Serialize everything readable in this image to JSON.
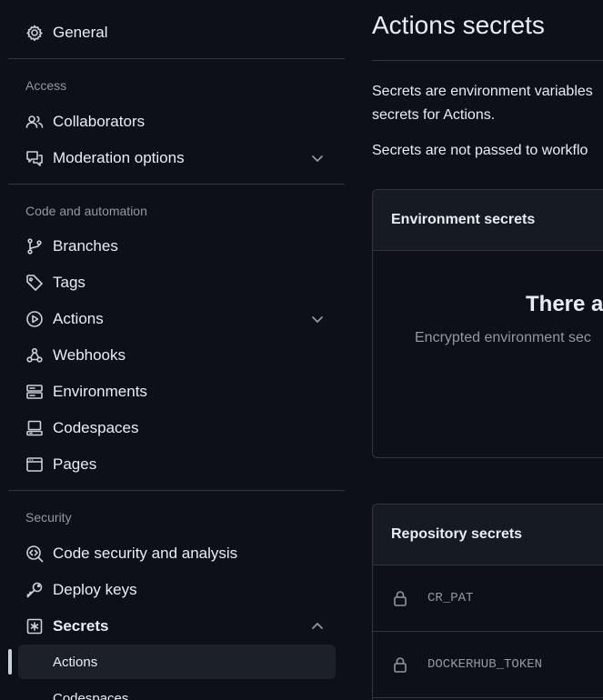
{
  "sidebar": {
    "general": "General",
    "access_heading": "Access",
    "access_items": [
      "Collaborators",
      "Moderation options"
    ],
    "code_heading": "Code and automation",
    "code_items": [
      "Branches",
      "Tags",
      "Actions",
      "Webhooks",
      "Environments",
      "Codespaces",
      "Pages"
    ],
    "security_heading": "Security",
    "security_items": [
      "Code security and analysis",
      "Deploy keys",
      "Secrets"
    ],
    "secrets_sub": [
      "Actions",
      "Codespaces"
    ]
  },
  "main": {
    "title": "Actions secrets",
    "desc_line1": "Secrets are environment variables",
    "desc_line2": "secrets for Actions.",
    "desc_line3": "Secrets are not passed to workflo",
    "env_box": {
      "title": "Environment secrets",
      "empty_title": "There ar",
      "empty_sub": "Encrypted environment sec"
    },
    "repo_box": {
      "title": "Repository secrets",
      "secrets": [
        "CR_PAT",
        "DOCKERHUB_TOKEN"
      ]
    }
  },
  "colors": {
    "background": "#0d1117",
    "panel_header": "#161b22",
    "border": "#30363d",
    "muted_text": "#9198a1",
    "active_bg": "#1c2128"
  }
}
